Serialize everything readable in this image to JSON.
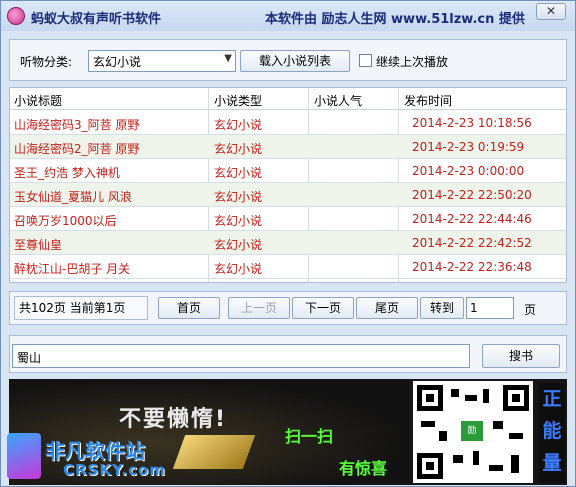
{
  "window": {
    "title": "蚂蚁大叔有声听书软件",
    "publisher": "本软件由 励志人生网 www.51lzw.cn 提供",
    "close_glyph": "✕"
  },
  "filter": {
    "category_label": "听物分类:",
    "category_value": "玄幻小说",
    "load_button": "载入小说列表",
    "resume_label": "继续上次播放",
    "resume_checked": false
  },
  "table": {
    "columns": [
      "小说标题",
      "小说类型",
      "小说人气",
      "发布时间"
    ],
    "rows": [
      {
        "title": "山海经密码3_阿菩 原野",
        "type": "玄幻小说",
        "popularity": "",
        "date": "2014-2-23 10:18:56"
      },
      {
        "title": "山海经密码2_阿菩 原野",
        "type": "玄幻小说",
        "popularity": "",
        "date": "2014-2-23 0:19:59"
      },
      {
        "title": "圣王_约浩 梦入神机",
        "type": "玄幻小说",
        "popularity": "",
        "date": "2014-2-23 0:00:00"
      },
      {
        "title": "玉女仙道_夏猫儿 风浪",
        "type": "玄幻小说",
        "popularity": "",
        "date": "2014-2-22 22:50:20"
      },
      {
        "title": "召唤万岁1000以后",
        "type": "玄幻小说",
        "popularity": "",
        "date": "2014-2-22 22:44:46"
      },
      {
        "title": "至尊仙皇",
        "type": "玄幻小说",
        "popularity": "",
        "date": "2014-2-22 22:42:52"
      },
      {
        "title": "醉枕江山-巴胡子 月关",
        "type": "玄幻小说",
        "popularity": "",
        "date": "2014-2-22 22:36:48"
      }
    ],
    "text_color": "#c0211a"
  },
  "pager": {
    "info": "共102页   当前第1页",
    "first": "首页",
    "prev": "上一页",
    "next": "下一页",
    "last": "尾页",
    "goto": "转到",
    "page_value": "1",
    "page_unit": "页"
  },
  "search": {
    "value": "蜀山",
    "button": "搜书"
  },
  "banner": {
    "slogan": "不要懒惰!",
    "scan_text": "扫一扫",
    "surprise_text": "有惊喜",
    "energy_text": "正能量",
    "qr_logo_text": "励"
  },
  "watermark": {
    "name": "非凡软件站",
    "domain": "CRSKY.com"
  }
}
